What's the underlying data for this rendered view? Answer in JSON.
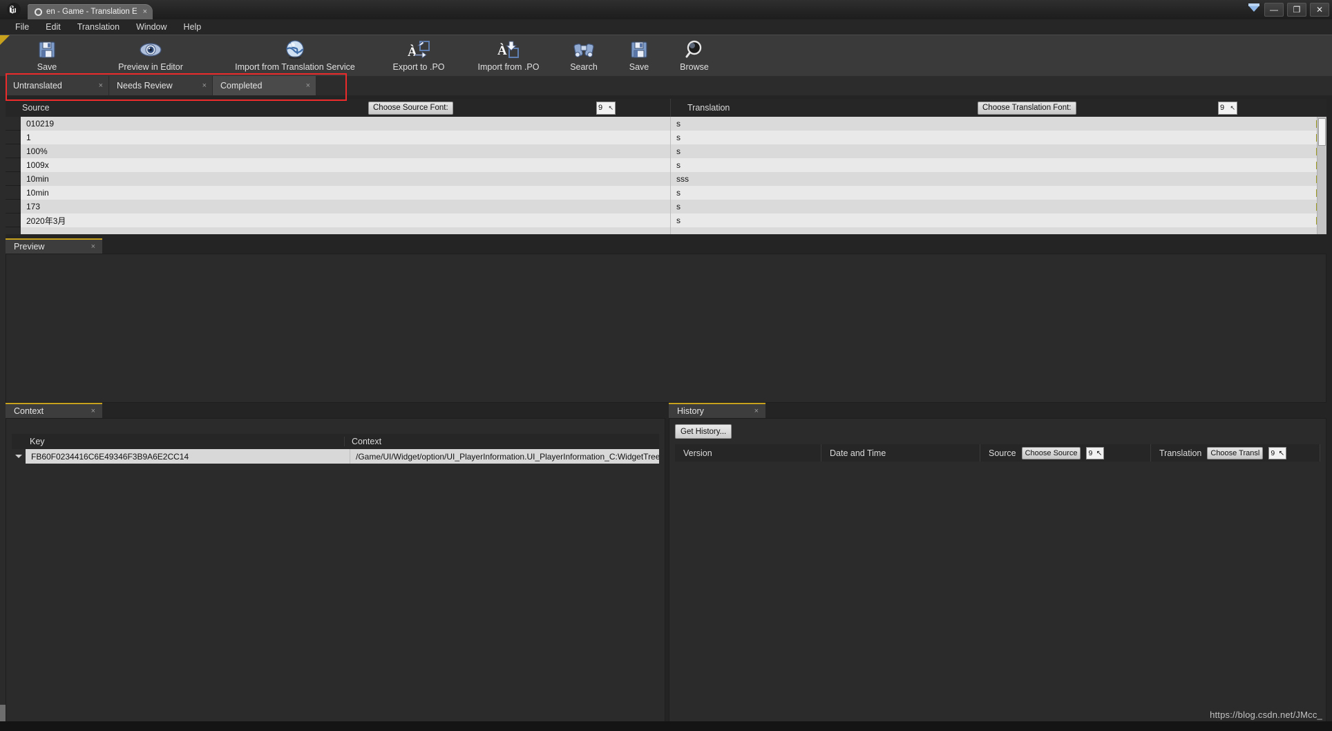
{
  "window": {
    "app_logo": "unreal-engine-logo",
    "document_tab": "en - Game - Translation E",
    "tab_close": "×",
    "minimize": "—",
    "restore": "❐",
    "close": "✕"
  },
  "menubar": {
    "items": [
      {
        "label": "File"
      },
      {
        "label": "Edit"
      },
      {
        "label": "Translation"
      },
      {
        "label": "Window"
      },
      {
        "label": "Help"
      }
    ]
  },
  "toolbar": {
    "buttons": [
      {
        "label": "Save",
        "icon": "floppy-disk-icon"
      },
      {
        "label": "Preview in Editor",
        "icon": "eye-icon"
      },
      {
        "label": "Import from Translation Service",
        "icon": "globe-icon"
      },
      {
        "label": "Export to .PO",
        "icon": "export-po-icon"
      },
      {
        "label": "Import from .PO",
        "icon": "import-po-icon"
      },
      {
        "label": "Search",
        "icon": "binoculars-icon"
      },
      {
        "label": "Save",
        "icon": "floppy-disk-icon"
      },
      {
        "label": "Browse",
        "icon": "magnifier-icon"
      }
    ]
  },
  "filter_tabs": {
    "items": [
      {
        "label": "Untranslated",
        "close": "×",
        "active": false
      },
      {
        "label": "Needs Review",
        "close": "×",
        "active": false
      },
      {
        "label": "Completed",
        "close": "×",
        "active": true
      }
    ]
  },
  "grid_header": {
    "source_label": "Source",
    "source_font_button": "Choose Source Font:",
    "source_font_size": "9",
    "translation_label": "Translation",
    "translation_font_button": "Choose Translation Font:",
    "translation_font_size": "9",
    "spin_arrow": "↖"
  },
  "grid_rows": [
    {
      "source": "010219",
      "translation": "s"
    },
    {
      "source": "1",
      "translation": "s"
    },
    {
      "source": "100%",
      "translation": "s"
    },
    {
      "source": "1009x",
      "translation": "s"
    },
    {
      "source": "10min",
      "translation": "sss"
    },
    {
      "source": "10min",
      "translation": "s"
    },
    {
      "source": "173",
      "translation": "s"
    },
    {
      "source": "2020年3月",
      "translation": "s"
    }
  ],
  "preview_panel": {
    "tab_label": "Preview",
    "tab_close": "×"
  },
  "context_panel": {
    "tab_label": "Context",
    "tab_close": "×",
    "columns": [
      "Key",
      "Context"
    ],
    "rows": [
      {
        "key": "FB60F0234416C6E49346F3B9A6E2CC14",
        "context": "/Game/UI/Widget/option/UI_PlayerInformation.UI_PlayerInformation_C:WidgetTree.T"
      }
    ]
  },
  "history_panel": {
    "tab_label": "History",
    "tab_close": "×",
    "get_history_button": "Get History...",
    "columns": {
      "version": "Version",
      "date_and_time": "Date and Time",
      "source": "Source",
      "source_font_button": "Choose Source",
      "source_font_size": "9",
      "translation": "Translation",
      "translation_font_button": "Choose Transl",
      "translation_font_size": "9"
    }
  },
  "watermark": "https://blog.csdn.net/JMcc_",
  "colors": {
    "accent_tab": "#c8a21c",
    "highlight_box": "#ed2b2b",
    "panel_bg": "#2b2b2b",
    "toolbar_bg": "#3a3a3a",
    "grid_row_odd": "#dadada",
    "grid_row_even": "#e9e9e9",
    "edit_glyph": "#e9e44a"
  }
}
